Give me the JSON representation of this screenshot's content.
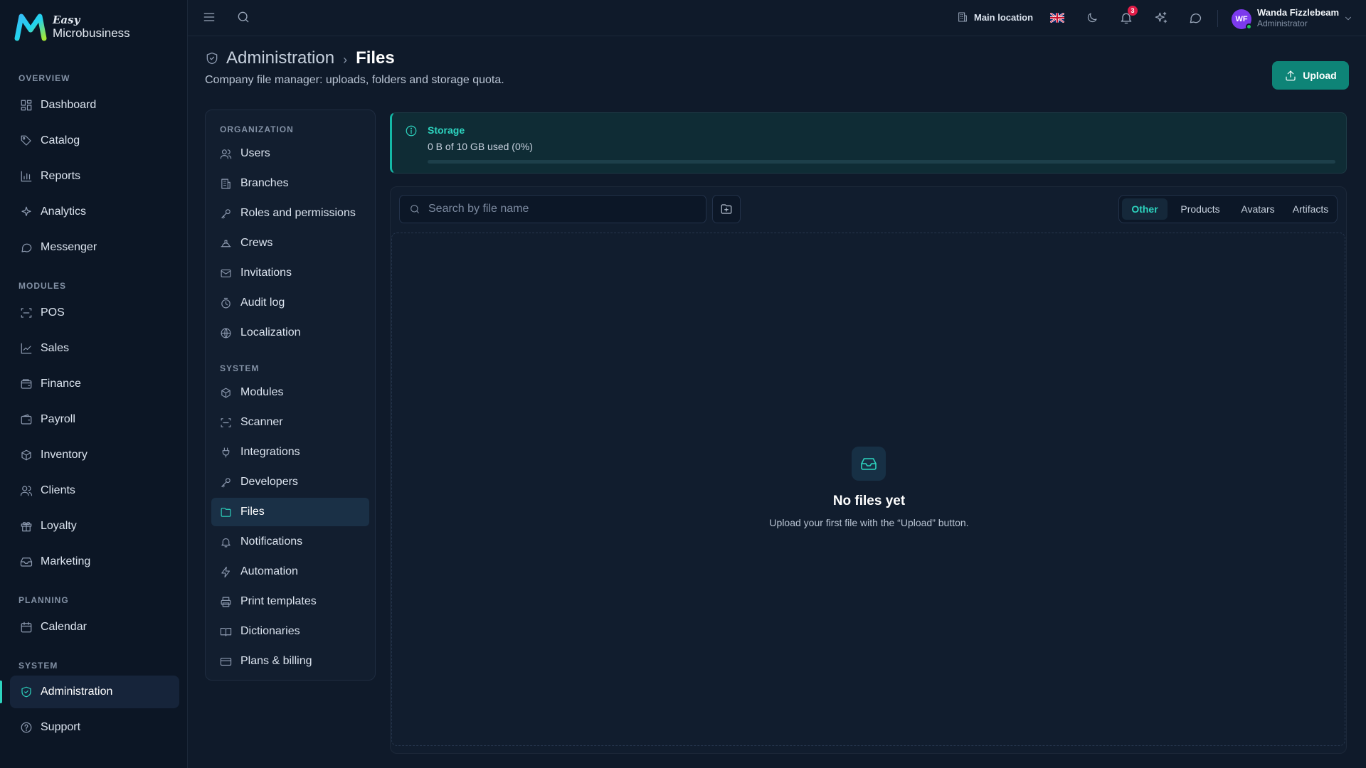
{
  "brand": {
    "top": "Easy",
    "name": "Microbusiness"
  },
  "sidebar": {
    "sections": [
      "OVERVIEW",
      "MODULES",
      "PLANNING",
      "SYSTEM"
    ],
    "items": [
      {
        "label": "Dashboard",
        "icon": "dashboard-icon"
      },
      {
        "label": "Catalog",
        "icon": "catalog-icon"
      },
      {
        "label": "Reports",
        "icon": "reports-icon"
      },
      {
        "label": "Analytics",
        "icon": "analytics-icon"
      },
      {
        "label": "Messenger",
        "icon": "messenger-icon"
      },
      {
        "label": "POS",
        "icon": "pos-icon"
      },
      {
        "label": "Sales",
        "icon": "sales-icon"
      },
      {
        "label": "Finance",
        "icon": "finance-icon"
      },
      {
        "label": "Payroll",
        "icon": "payroll-icon"
      },
      {
        "label": "Inventory",
        "icon": "inventory-icon"
      },
      {
        "label": "Clients",
        "icon": "clients-icon"
      },
      {
        "label": "Loyalty",
        "icon": "loyalty-icon"
      },
      {
        "label": "Marketing",
        "icon": "marketing-icon"
      },
      {
        "label": "Calendar",
        "icon": "calendar-icon"
      },
      {
        "label": "Administration",
        "icon": "shield-icon",
        "active": true
      },
      {
        "label": "Support",
        "icon": "help-icon"
      }
    ]
  },
  "topbar": {
    "location": "Main location",
    "language": "en-GB",
    "notifications_count": "3",
    "user": {
      "initials": "WF",
      "name": "Wanda Fizzlebeam",
      "role": "Administrator"
    }
  },
  "header": {
    "breadcrumb_parent": "Administration",
    "breadcrumb_separator": "›",
    "title": "Files",
    "subtitle": "Company file manager: uploads, folders and storage quota.",
    "upload_label": "Upload"
  },
  "subnav": {
    "sections": [
      "ORGANIZATION",
      "SYSTEM"
    ],
    "items": [
      {
        "label": "Users",
        "icon": "users-icon"
      },
      {
        "label": "Branches",
        "icon": "building-icon"
      },
      {
        "label": "Roles and permissions",
        "icon": "key-icon"
      },
      {
        "label": "Crews",
        "icon": "crews-icon"
      },
      {
        "label": "Invitations",
        "icon": "mail-icon"
      },
      {
        "label": "Audit log",
        "icon": "audit-icon"
      },
      {
        "label": "Localization",
        "icon": "globe-icon"
      },
      {
        "label": "Modules",
        "icon": "modules-icon"
      },
      {
        "label": "Scanner",
        "icon": "scanner-icon"
      },
      {
        "label": "Integrations",
        "icon": "plug-icon"
      },
      {
        "label": "Developers",
        "icon": "key-icon"
      },
      {
        "label": "Files",
        "icon": "folder-icon",
        "active": true
      },
      {
        "label": "Notifications",
        "icon": "bell-icon"
      },
      {
        "label": "Automation",
        "icon": "bolt-icon"
      },
      {
        "label": "Print templates",
        "icon": "printer-icon"
      },
      {
        "label": "Dictionaries",
        "icon": "book-icon"
      },
      {
        "label": "Plans & billing",
        "icon": "card-icon"
      }
    ]
  },
  "storage": {
    "title": "Storage",
    "usage_text": "0 B of 10 GB used (0%)",
    "used_fraction": 0
  },
  "files": {
    "search_placeholder": "Search by file name",
    "tabs": [
      {
        "label": "Other",
        "active": true
      },
      {
        "label": "Products"
      },
      {
        "label": "Avatars"
      },
      {
        "label": "Artifacts"
      }
    ],
    "empty_title": "No files yet",
    "empty_text": "Upload your first file with the “Upload” button."
  },
  "colors": {
    "accent": "#2dd4bf",
    "primary_button": "#0e8477",
    "background": "#0f1a2a"
  }
}
